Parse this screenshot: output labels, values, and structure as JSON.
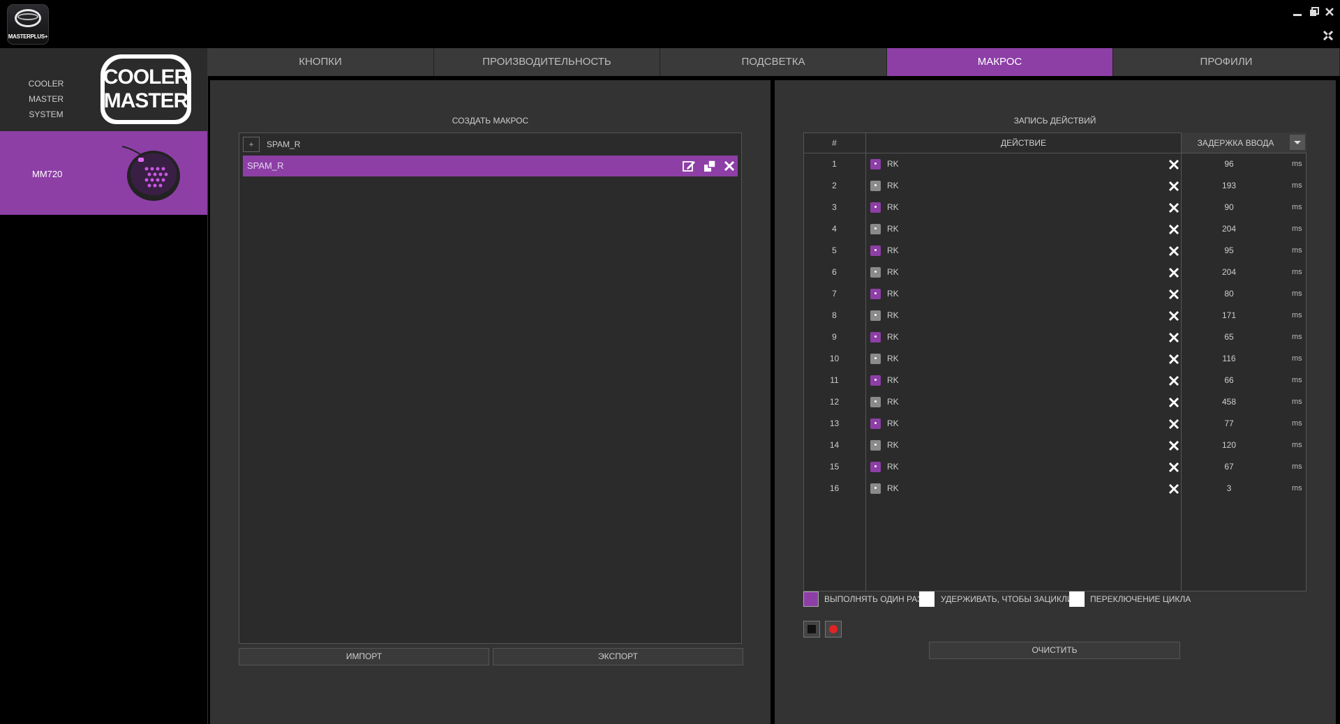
{
  "app": {
    "logo_text": "MASTERPLUS+",
    "window_icons": [
      "minimize-icon",
      "restore-icon",
      "close-icon",
      "settings-icon"
    ]
  },
  "sidebar": {
    "brand_line1": "COOLER MASTER",
    "brand_line2": "SYSTEM",
    "logo_line1": "COOLER",
    "logo_line2": "MASTER",
    "device_name": "MM720"
  },
  "tabs": [
    {
      "label": "КНОПКИ"
    },
    {
      "label": "ПРОИЗВОДИТЕЛЬНОСТЬ"
    },
    {
      "label": "ПОДСВЕТКА"
    },
    {
      "label": "МАКРОС",
      "active": true
    },
    {
      "label": "ПРОФИЛИ"
    }
  ],
  "macro": {
    "section_title": "СОЗДАТЬ МАКРОС",
    "add_symbol": "+",
    "name_value": "SPAM_R",
    "selected_macro": "SPAM_R",
    "import_label": "ИМПОРТ",
    "export_label": "ЭКСПОРТ"
  },
  "record": {
    "section_title": "ЗАПИСЬ ДЕЙСТВИЙ",
    "col_num": "#",
    "col_action": "ДЕЙСТВИЕ",
    "col_delay": "ЗАДЕРЖКА ВВОДА",
    "unit": "ms",
    "rows": [
      {
        "n": "1",
        "action": "RK",
        "type": "down",
        "delay": "96"
      },
      {
        "n": "2",
        "action": "RK",
        "type": "up",
        "delay": "193"
      },
      {
        "n": "3",
        "action": "RK",
        "type": "down",
        "delay": "90"
      },
      {
        "n": "4",
        "action": "RK",
        "type": "up",
        "delay": "204"
      },
      {
        "n": "5",
        "action": "RK",
        "type": "down",
        "delay": "95"
      },
      {
        "n": "6",
        "action": "RK",
        "type": "up",
        "delay": "204"
      },
      {
        "n": "7",
        "action": "RK",
        "type": "down",
        "delay": "80"
      },
      {
        "n": "8",
        "action": "RK",
        "type": "up",
        "delay": "171"
      },
      {
        "n": "9",
        "action": "RK",
        "type": "down",
        "delay": "65"
      },
      {
        "n": "10",
        "action": "RK",
        "type": "up",
        "delay": "116"
      },
      {
        "n": "11",
        "action": "RK",
        "type": "down",
        "delay": "66"
      },
      {
        "n": "12",
        "action": "RK",
        "type": "up",
        "delay": "458"
      },
      {
        "n": "13",
        "action": "RK",
        "type": "down",
        "delay": "77"
      },
      {
        "n": "14",
        "action": "RK",
        "type": "up",
        "delay": "120"
      },
      {
        "n": "15",
        "action": "RK",
        "type": "down",
        "delay": "67"
      },
      {
        "n": "16",
        "action": "RK",
        "type": "up",
        "delay": "3"
      }
    ],
    "options": [
      {
        "label": "ВЫПОЛНЯТЬ ОДИН РАЗ",
        "checked": true
      },
      {
        "label": "УДЕРЖИВАТЬ, ЧТОБЫ ЗАЦИКЛИТЬ",
        "checked": false
      },
      {
        "label": "ПЕРЕКЛЮЧЕНИЕ ЦИКЛА",
        "checked": false
      }
    ],
    "clear_label": "ОЧИСТИТЬ"
  },
  "colors": {
    "accent": "#8d3fa6",
    "panel": "#333333",
    "list_bg": "#2b2b2b",
    "key_up": "#8a8a8a"
  }
}
